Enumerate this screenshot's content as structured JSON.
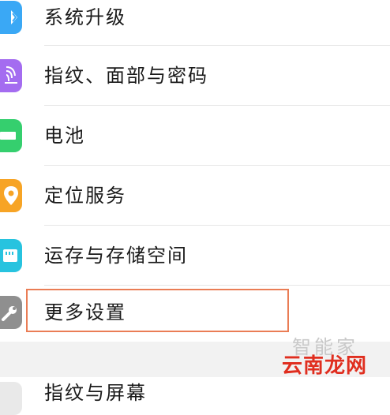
{
  "settings": {
    "items": [
      {
        "label": "系统升级",
        "icon": "system-update-icon",
        "color": "#3aa8f5"
      },
      {
        "label": "指纹、面部与密码",
        "icon": "fingerprint-icon",
        "color": "#a46cf0"
      },
      {
        "label": "电池",
        "icon": "battery-icon",
        "color": "#35cf6e"
      },
      {
        "label": "定位服务",
        "icon": "location-icon",
        "color": "#f7a425"
      },
      {
        "label": "运存与存储空间",
        "icon": "storage-icon",
        "color": "#27c3df"
      },
      {
        "label": "更多设置",
        "icon": "wrench-icon",
        "color": "#8f8f8f"
      }
    ],
    "partial_item": {
      "label": "指纹与屏幕"
    }
  },
  "watermark": {
    "text_en": "云南龙网",
    "text_zh": "智能家"
  },
  "highlight_color": "#ea7d55"
}
